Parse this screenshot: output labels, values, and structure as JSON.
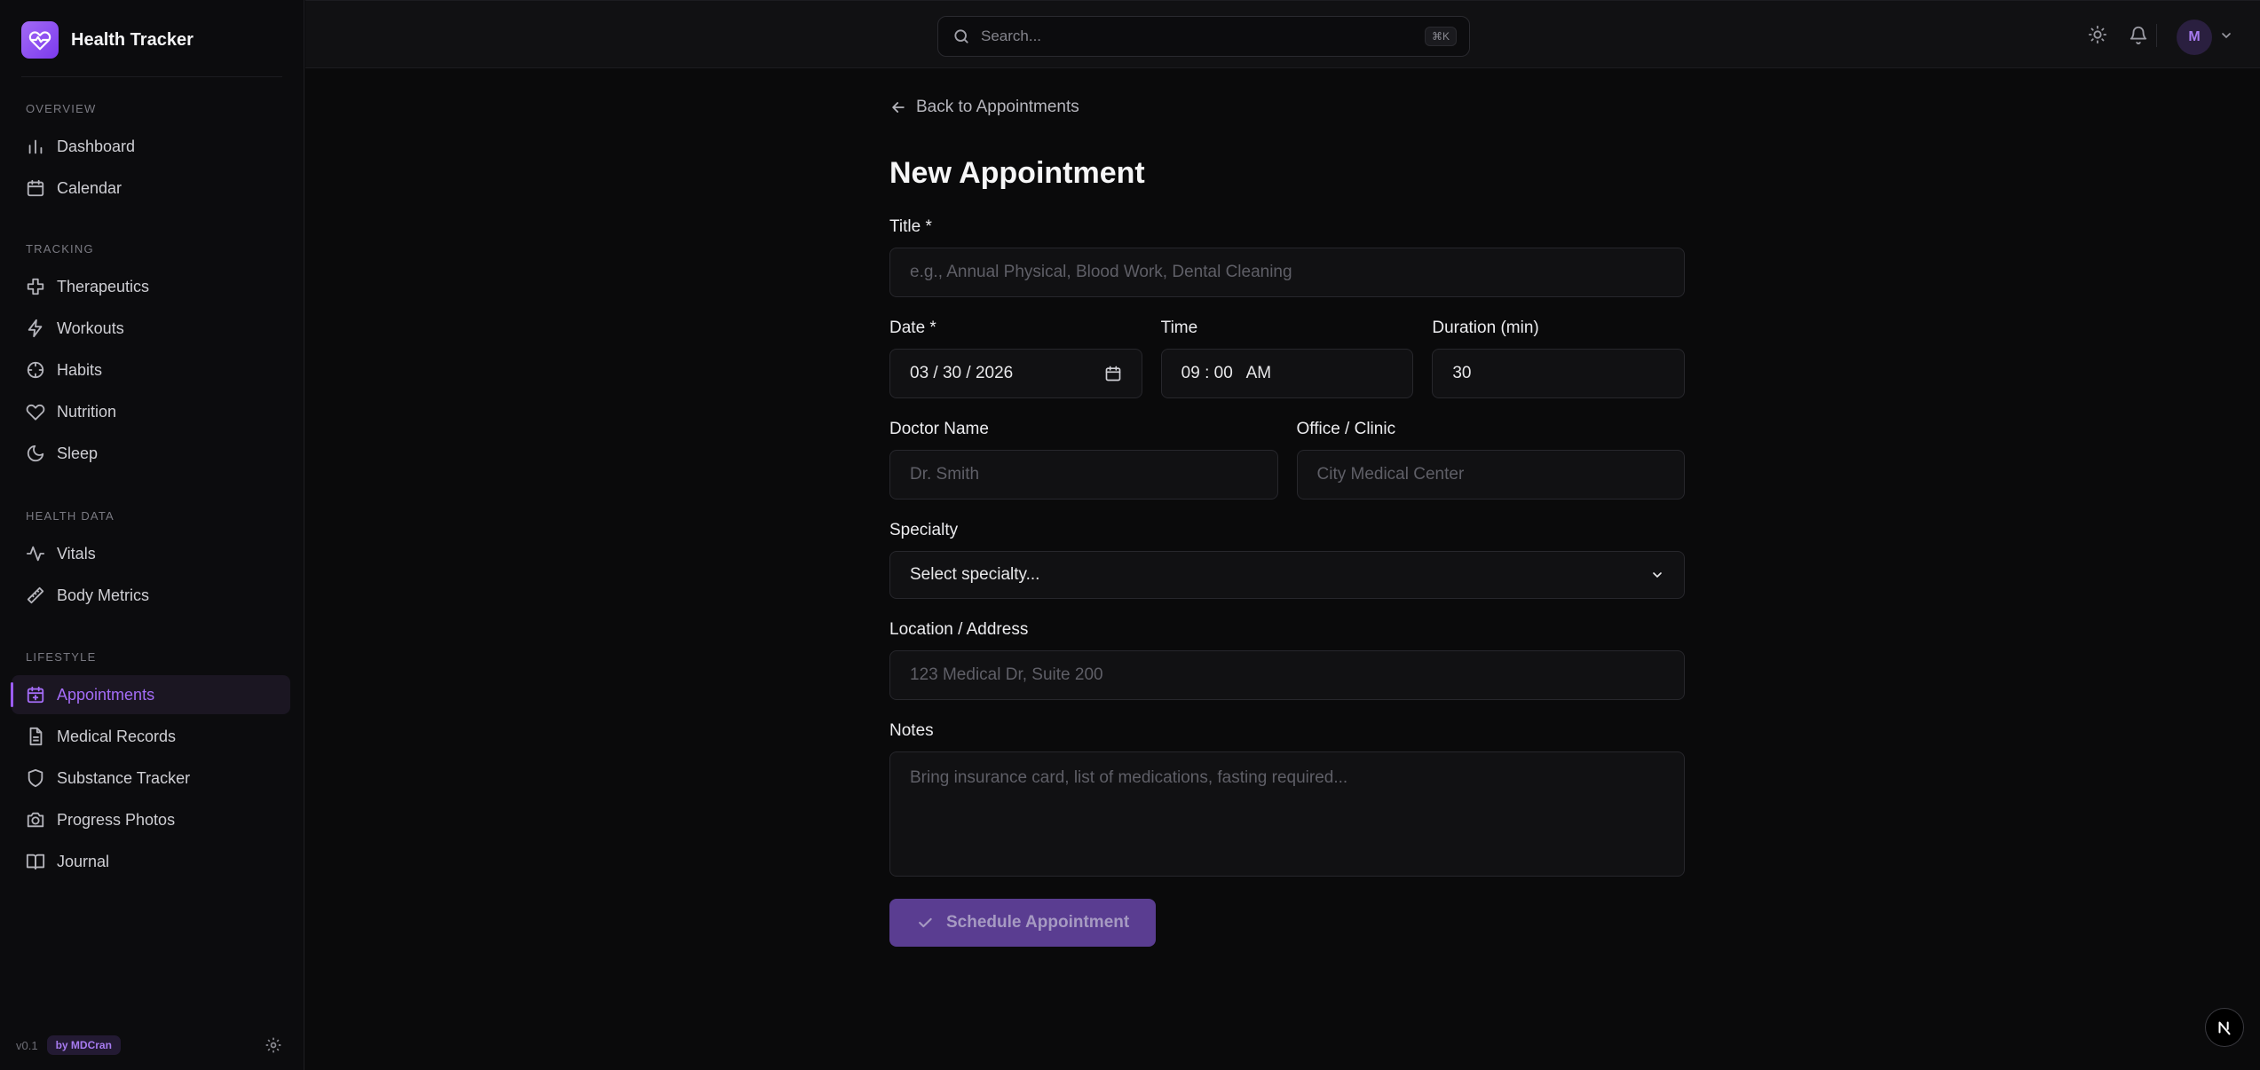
{
  "app": {
    "name": "Health Tracker",
    "version": "v0.1",
    "by": "by MDCran"
  },
  "sidebar": {
    "sections": [
      {
        "heading": "OVERVIEW",
        "items": [
          {
            "label": "Dashboard",
            "icon": "bar-chart-icon"
          },
          {
            "label": "Calendar",
            "icon": "calendar-icon"
          }
        ]
      },
      {
        "heading": "TRACKING",
        "items": [
          {
            "label": "Therapeutics",
            "icon": "cross-icon"
          },
          {
            "label": "Workouts",
            "icon": "lightning-icon"
          },
          {
            "label": "Habits",
            "icon": "target-icon"
          },
          {
            "label": "Nutrition",
            "icon": "heart-icon"
          },
          {
            "label": "Sleep",
            "icon": "moon-icon"
          }
        ]
      },
      {
        "heading": "HEALTH DATA",
        "items": [
          {
            "label": "Vitals",
            "icon": "pulse-icon"
          },
          {
            "label": "Body Metrics",
            "icon": "ruler-icon"
          }
        ]
      },
      {
        "heading": "LIFESTYLE",
        "items": [
          {
            "label": "Appointments",
            "icon": "calendar-plus-icon",
            "active": true
          },
          {
            "label": "Medical Records",
            "icon": "document-icon"
          },
          {
            "label": "Substance Tracker",
            "icon": "shield-icon"
          },
          {
            "label": "Progress Photos",
            "icon": "camera-icon"
          },
          {
            "label": "Journal",
            "icon": "book-icon"
          }
        ]
      }
    ]
  },
  "topbar": {
    "search_placeholder": "Search...",
    "shortcut": "⌘K",
    "avatar_initial": "M"
  },
  "form": {
    "back_label": "Back to Appointments",
    "title": "New Appointment",
    "title_label": "Title *",
    "title_placeholder": "e.g., Annual Physical, Blood Work, Dental Cleaning",
    "date_label": "Date *",
    "date_value": "03 / 30 / 2026",
    "time_label": "Time",
    "time_value": "09 : 00   AM",
    "duration_label": "Duration (min)",
    "duration_value": "30",
    "doctor_label": "Doctor Name",
    "doctor_placeholder": "Dr. Smith",
    "office_label": "Office / Clinic",
    "office_placeholder": "City Medical Center",
    "specialty_label": "Specialty",
    "specialty_value": "Select specialty...",
    "location_label": "Location / Address",
    "location_placeholder": "123 Medical Dr, Suite 200",
    "notes_label": "Notes",
    "notes_placeholder": "Bring insurance card, list of medications, fasting required...",
    "submit_label": "Schedule Appointment"
  },
  "colors": {
    "accent": "#9b5cf6",
    "background": "#0a0a0b",
    "button": "#5a3d91"
  }
}
